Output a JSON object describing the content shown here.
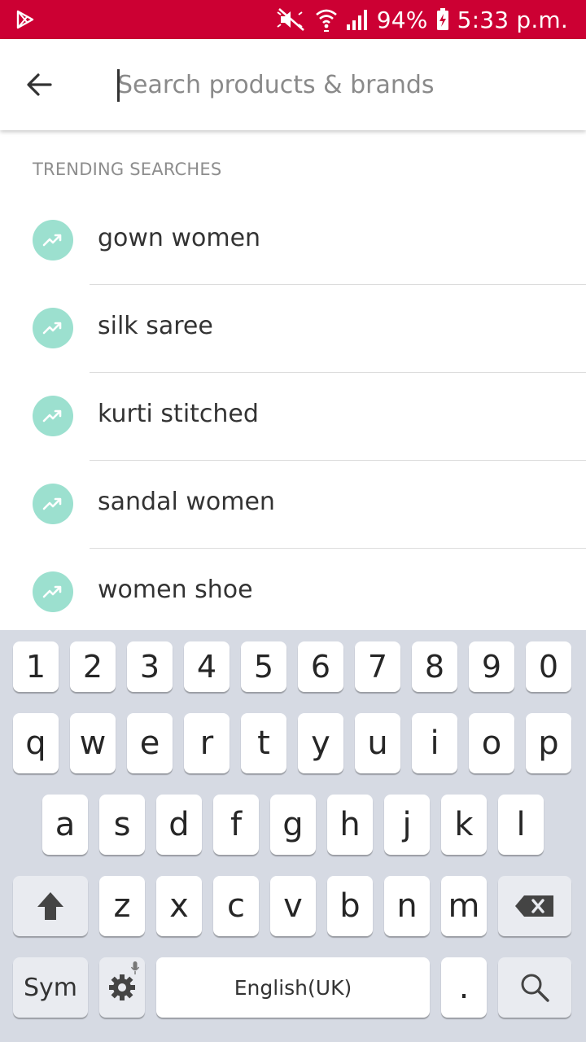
{
  "status_bar": {
    "battery": "94%",
    "time": "5:33 p.m.",
    "color": "#cc0033",
    "icons": [
      "play-store-icon",
      "mute-icon",
      "wifi-icon",
      "signal-icon",
      "battery-charging-icon"
    ]
  },
  "search": {
    "placeholder": "Search products & brands",
    "value": ""
  },
  "trending": {
    "title": "TRENDING SEARCHES",
    "badge_color": "#9ce0cf",
    "items": [
      {
        "label": "gown women"
      },
      {
        "label": "silk saree"
      },
      {
        "label": "kurti stitched"
      },
      {
        "label": "sandal women"
      },
      {
        "label": "women shoe"
      }
    ]
  },
  "keyboard": {
    "numbers": [
      "1",
      "2",
      "3",
      "4",
      "5",
      "6",
      "7",
      "8",
      "9",
      "0"
    ],
    "row1": [
      "q",
      "w",
      "e",
      "r",
      "t",
      "y",
      "u",
      "i",
      "o",
      "p"
    ],
    "row2": [
      "a",
      "s",
      "d",
      "f",
      "g",
      "h",
      "j",
      "k",
      "l"
    ],
    "row3": [
      "z",
      "x",
      "c",
      "v",
      "b",
      "n",
      "m"
    ],
    "sym_label": "Sym",
    "space_label": "English(UK)",
    "period_label": "."
  }
}
